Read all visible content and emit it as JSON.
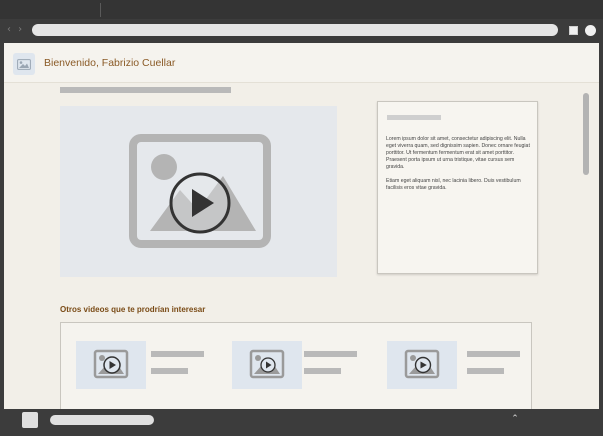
{
  "browser": {
    "nav_arrows": "‹ ›",
    "bottom_chevron": "⌃"
  },
  "header": {
    "greeting": "Bienvenido, Fabrizio Cuellar",
    "avatar_icon": "image-icon"
  },
  "main_video": {
    "icon": "image-icon",
    "play_icon": "play-icon"
  },
  "side_card": {
    "paragraphs": [
      "Lorem ipsum dolor sit amet, consectetur adipiscing elit. Nulla eget viverra quam, sed dignissim sapien. Donec ornare feugiat porttitor. Ut fermentum fermentum erat sit amet porttitor. Praesent porta ipsum ut urna tristique, vitae cursus sem gravida.",
      "Etiam eget aliquam nisl, nec lacinia libero. Duis vestibulum facilisis eros vitae gravida."
    ]
  },
  "others": {
    "title": "Otros videos que te prodrían interesar"
  },
  "colors": {
    "accent_text": "#8a5a26",
    "section_title": "#7a4b16",
    "page_bg": "#f2efe8",
    "placeholder": "#b9b9b9",
    "chrome": "#3c3c3c"
  }
}
